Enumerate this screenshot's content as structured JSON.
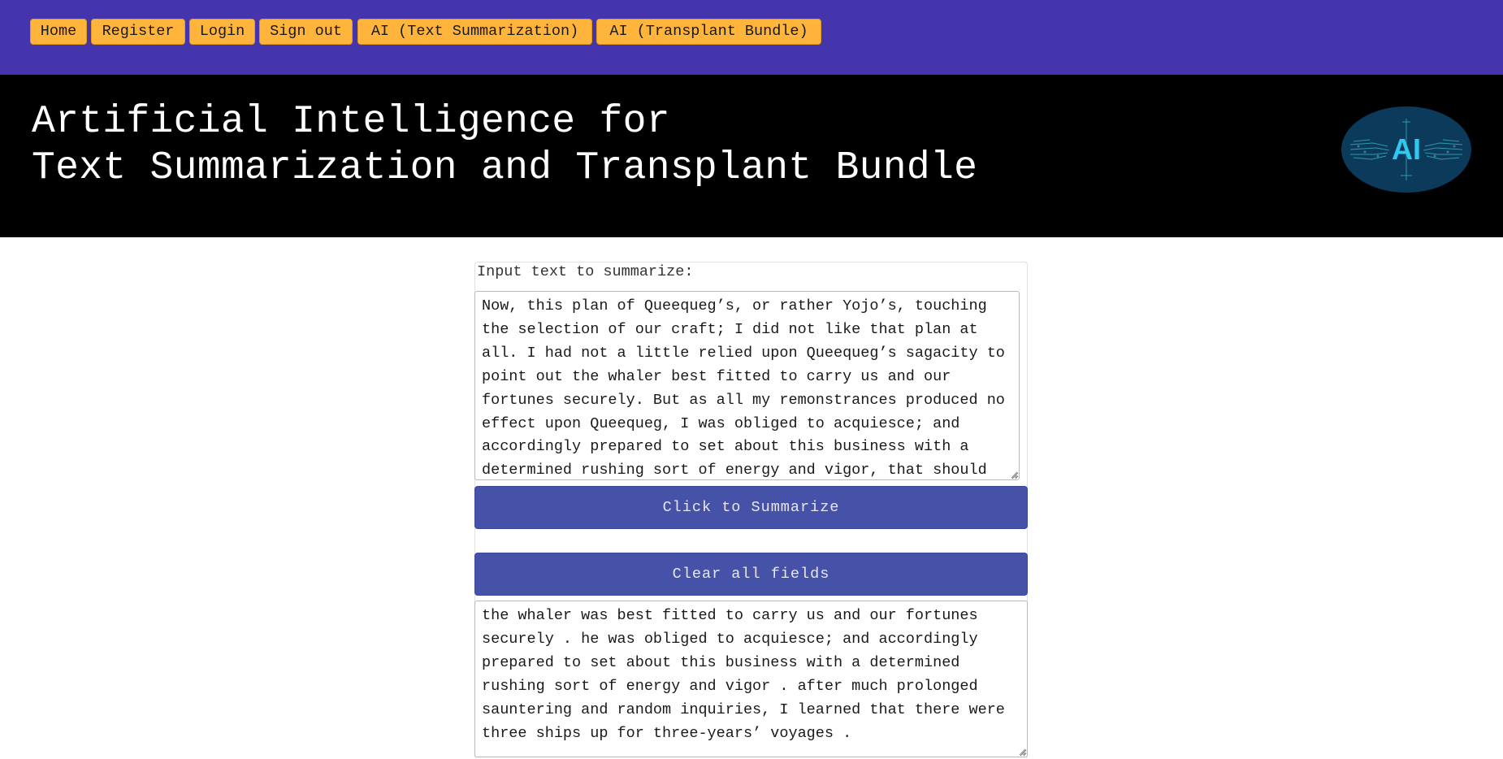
{
  "nav": {
    "items": [
      {
        "label": "Home"
      },
      {
        "label": "Register"
      },
      {
        "label": "Login"
      },
      {
        "label": "Sign out"
      },
      {
        "label": "AI (Text Summarization)"
      },
      {
        "label": "AI (Transplant Bundle)"
      }
    ]
  },
  "banner": {
    "title_line1": "Artificial Intelligence for",
    "title_line2": "Text Summarization and Transplant Bundle",
    "logo_text": "AI"
  },
  "form": {
    "input_label": "Input text to summarize:",
    "input_value": "Now, this plan of Queequeg’s, or rather Yojo’s, touching the selection of our craft; I did not like that plan at all. I had not a little relied upon Queequeg’s sagacity to point out the whaler best fitted to carry us and our fortunes securely. But as all my remonstrances produced no effect upon Queequeg, I was obliged to acquiesce; and accordingly prepared to set about this business with a determined rushing sort of energy and vigor, that should",
    "summarize_label": "Click to Summarize",
    "clear_label": "Clear all fields",
    "output_value": "the whaler was best fitted to carry us and our fortunes securely . he was obliged to acquiesce; and accordingly prepared to set about this business with a determined rushing sort of energy and vigor . after much prolonged sauntering and random inquiries, I learned that there were three ships up for three-years’ voyages ."
  },
  "colors": {
    "navbar": "#4535ad",
    "nav_button": "#ffb43c",
    "banner": "#000000",
    "action_button": "#4552a8",
    "logo_bg": "#0b3a5a",
    "logo_text": "#2ec8f0"
  }
}
